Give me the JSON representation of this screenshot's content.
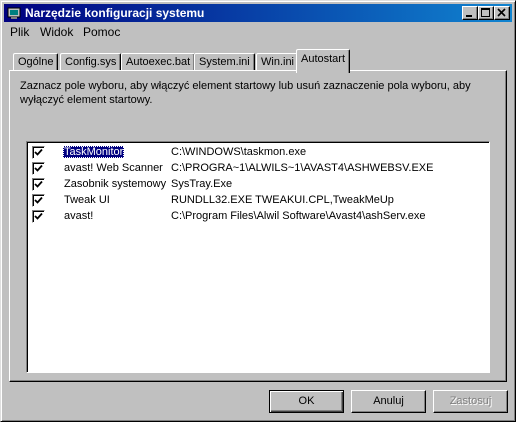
{
  "window": {
    "title": "Narzędzie konfiguracji systemu"
  },
  "menu": [
    "Plik",
    "Widok",
    "Pomoc"
  ],
  "tabs": [
    "Ogólne",
    "Config.sys",
    "Autoexec.bat",
    "System.ini",
    "Win.ini",
    "Autostart"
  ],
  "active_tab": "Autostart",
  "description": "Zaznacz pole wyboru, aby włączyć element startowy lub usuń zaznaczenie pola wyboru, aby wyłączyć element startowy.",
  "startup_items": [
    {
      "name": "TaskMonitor",
      "command": "C:\\WINDOWS\\taskmon.exe",
      "checked": true,
      "selected": true
    },
    {
      "name": "avast! Web Scanner",
      "command": "C:\\PROGRA~1\\ALWILS~1\\AVAST4\\ASHWEBSV.EXE",
      "checked": true
    },
    {
      "name": "Zasobnik systemowy",
      "command": "SysTray.Exe",
      "checked": true
    },
    {
      "name": "Tweak UI",
      "command": "RUNDLL32.EXE TWEAKUI.CPL,TweakMeUp",
      "checked": true
    },
    {
      "name": "avast!",
      "command": "C:\\Program Files\\Alwil Software\\Avast4\\ashServ.exe",
      "checked": true
    }
  ],
  "buttons": {
    "ok": "OK",
    "cancel": "Anuluj",
    "apply": "Zastosuj"
  }
}
